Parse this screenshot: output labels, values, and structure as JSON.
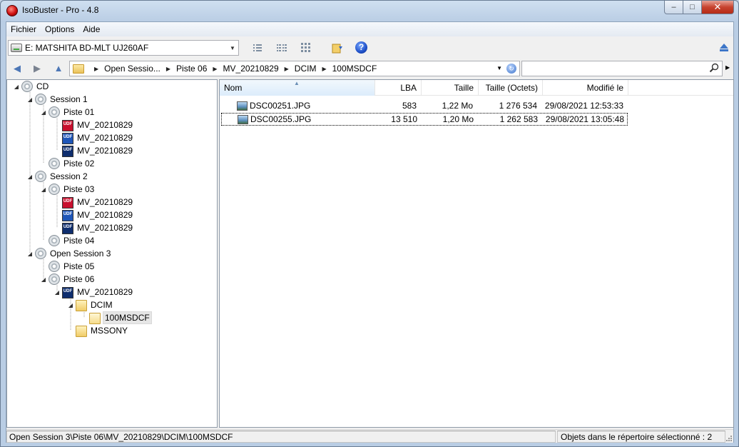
{
  "window": {
    "title": "IsoBuster - Pro - 4.8",
    "controls": {
      "minimize": "–",
      "maximize": "□",
      "close": "✕"
    }
  },
  "menu": [
    "Fichier",
    "Options",
    "Aide"
  ],
  "toolbar": {
    "drive": "E: MATSHITA  BD-MLT UJ260AF",
    "icons": [
      "view-list-icon",
      "view-details-icon",
      "view-large-icon",
      "extract-folder-icon",
      "help-icon",
      "eject-icon"
    ],
    "help_label": "?"
  },
  "navigation": {
    "back": "◀",
    "forward": "▶",
    "up": "▲",
    "breadcrumb": [
      "Open Sessio...",
      "Piste 06",
      "MV_20210829",
      "DCIM",
      "100MSDCF"
    ],
    "search_value": ""
  },
  "tree": [
    {
      "label": "CD",
      "icon": "disc",
      "level": 0
    },
    {
      "label": "Session 1",
      "icon": "disc",
      "level": 1
    },
    {
      "label": "Piste 01",
      "icon": "disc",
      "level": 2
    },
    {
      "label": "MV_20210829",
      "icon": "udf-red",
      "level": 3
    },
    {
      "label": "MV_20210829",
      "icon": "udf-blue",
      "level": 3
    },
    {
      "label": "MV_20210829",
      "icon": "udf-navy",
      "level": 3
    },
    {
      "label": "Piste 02",
      "icon": "disc",
      "level": 2
    },
    {
      "label": "Session 2",
      "icon": "disc",
      "level": 1
    },
    {
      "label": "Piste 03",
      "icon": "disc",
      "level": 2
    },
    {
      "label": "MV_20210829",
      "icon": "udf-red",
      "level": 3
    },
    {
      "label": "MV_20210829",
      "icon": "udf-blue",
      "level": 3
    },
    {
      "label": "MV_20210829",
      "icon": "udf-navy",
      "level": 3
    },
    {
      "label": "Piste 04",
      "icon": "disc",
      "level": 2
    },
    {
      "label": "Open Session 3",
      "icon": "disc",
      "level": 1
    },
    {
      "label": "Piste 05",
      "icon": "disc",
      "level": 2
    },
    {
      "label": "Piste 06",
      "icon": "disc",
      "level": 2
    },
    {
      "label": "MV_20210829",
      "icon": "udf-navy",
      "level": 3
    },
    {
      "label": "DCIM",
      "icon": "folder",
      "level": 4
    },
    {
      "label": "100MSDCF",
      "icon": "folder-open",
      "level": 5,
      "selected": true
    },
    {
      "label": "MSSONY",
      "icon": "folder-link",
      "level": 4
    }
  ],
  "list": {
    "columns": [
      "Nom",
      "LBA",
      "Taille",
      "Taille (Octets)",
      "Modifié le"
    ],
    "rows": [
      {
        "name": "DSC00251.JPG",
        "lba": "583",
        "size": "1,22 Mo",
        "bytes": "1 276 534",
        "modified": "29/08/2021 12:53:33"
      },
      {
        "name": "DSC00255.JPG",
        "lba": "13 510",
        "size": "1,20 Mo",
        "bytes": "1 262 583",
        "modified": "29/08/2021 13:05:48",
        "selected": true
      }
    ]
  },
  "status": {
    "path": "Open Session 3\\Piste 06\\MV_20210829\\DCIM\\100MSDCF",
    "count": "Objets dans le répertoire sélectionné : 2"
  }
}
